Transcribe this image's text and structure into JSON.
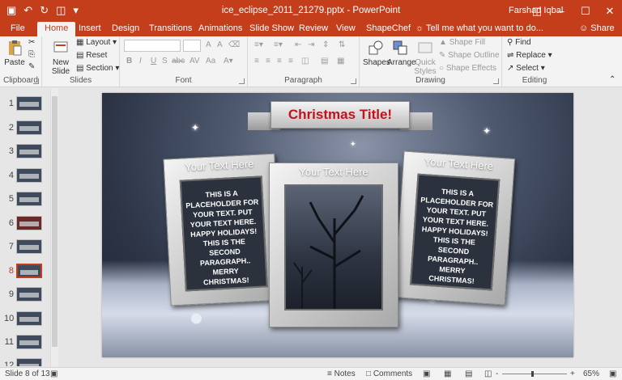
{
  "titlebar": {
    "doc_title": "ice_eclipse_2011_21279.pptx - PowerPoint",
    "user": "Farshad Iqbal"
  },
  "tabs": [
    {
      "label": "File",
      "active": false
    },
    {
      "label": "Home",
      "active": true
    },
    {
      "label": "Insert",
      "active": false
    },
    {
      "label": "Design",
      "active": false
    },
    {
      "label": "Transitions",
      "active": false
    },
    {
      "label": "Animations",
      "active": false
    },
    {
      "label": "Slide Show",
      "active": false
    },
    {
      "label": "Review",
      "active": false
    },
    {
      "label": "View",
      "active": false
    },
    {
      "label": "ShapeChef",
      "active": false
    }
  ],
  "tell_me": "Tell me what you want to do...",
  "share": "Share",
  "ribbon": {
    "clipboard": {
      "paste": "Paste",
      "label": "Clipboard"
    },
    "slides": {
      "new_slide": "New Slide",
      "layout": "Layout",
      "reset": "Reset",
      "section": "Section",
      "label": "Slides"
    },
    "font": {
      "label": "Font",
      "bold": "B",
      "italic": "I",
      "underline": "U",
      "strike": "S",
      "shadow": "abc",
      "spacing": "AV",
      "case": "Aa",
      "grow": "A",
      "shrink": "A"
    },
    "paragraph": {
      "label": "Paragraph"
    },
    "drawing": {
      "shapes": "Shapes",
      "arrange": "Arrange",
      "quick_styles": "Quick Styles",
      "shape_fill": "Shape Fill",
      "shape_outline": "Shape Outline",
      "shape_effects": "Shape Effects",
      "label": "Drawing"
    },
    "editing": {
      "find": "Find",
      "replace": "Replace",
      "select": "Select",
      "label": "Editing"
    }
  },
  "thumbnails": [
    "1",
    "2",
    "3",
    "4",
    "5",
    "6",
    "7",
    "8",
    "9",
    "10",
    "11",
    "12"
  ],
  "selected_slide": "8",
  "slide": {
    "title": "Christmas Title!",
    "left_header": "Your Text Here",
    "center_header": "Your Text Here",
    "right_header": "Your Text Here",
    "left_body": "THIS IS A PLACEHOLDER FOR YOUR TEXT. PUT YOUR TEXT HERE. HAPPY HOLIDAYS! THIS IS THE SECOND PARAGRAPH.. MERRY CHRISTMAS!",
    "right_body": "THIS IS A PLACEHOLDER FOR YOUR TEXT. PUT YOUR TEXT HERE. HAPPY HOLIDAYS! THIS IS THE SECOND PARAGRAPH.. MERRY CHRISTMAS!"
  },
  "status": {
    "slide_info": "Slide 8 of 13",
    "notes": "Notes",
    "comments": "Comments",
    "zoom": "65%",
    "minus": "-",
    "plus": "+"
  }
}
